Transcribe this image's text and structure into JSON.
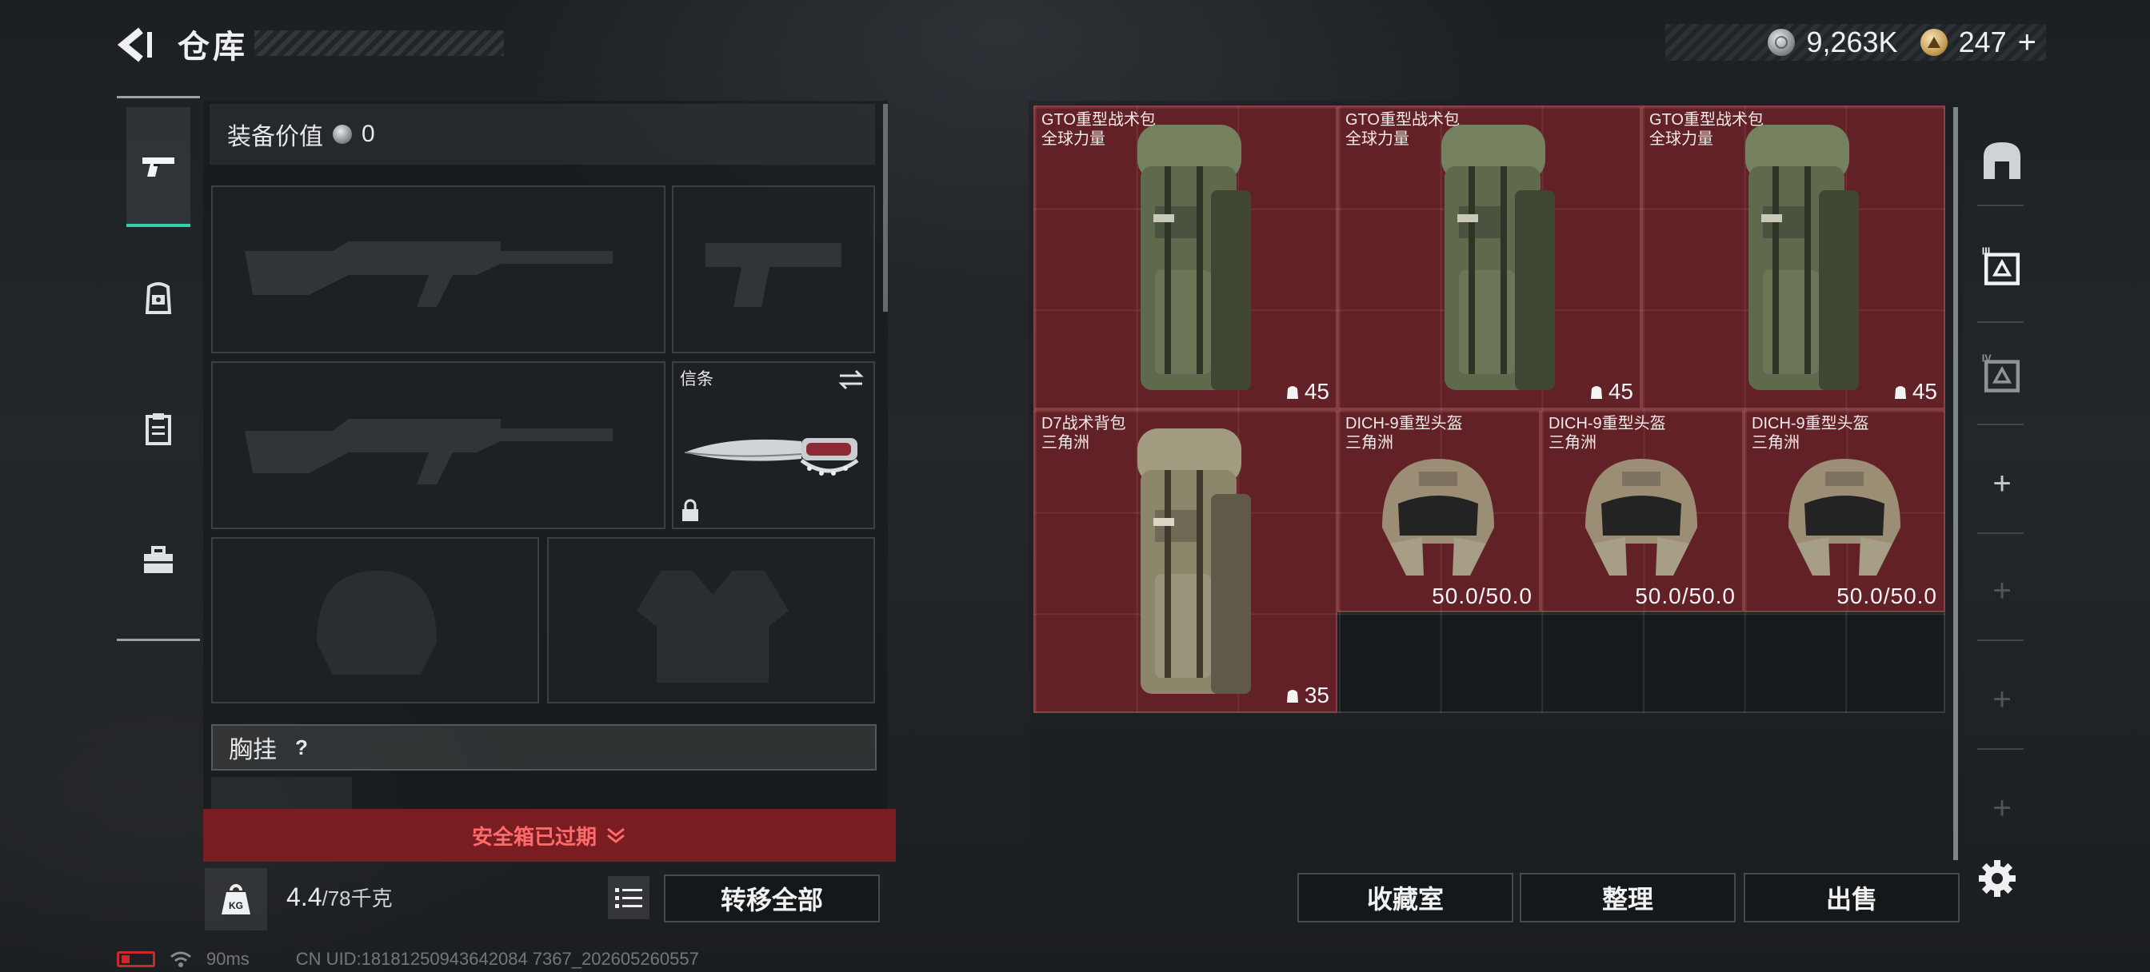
{
  "header": {
    "title": "仓库",
    "back_icon": "back-arrow-icon"
  },
  "currency": {
    "silver_amount": "9,263K",
    "gold_amount": "247",
    "gold_add": "+",
    "silver_icon": "silver-coin-icon",
    "gold_icon": "gold-coin-icon"
  },
  "left_tabs": [
    {
      "icon": "pistol-icon",
      "active": true
    },
    {
      "icon": "backpack-icon",
      "active": false
    },
    {
      "icon": "clipboard-icon",
      "active": false
    },
    {
      "icon": "toolbox-icon",
      "active": false
    }
  ],
  "loadout": {
    "value_label": "装备价值",
    "value_amount": "0",
    "melee_slot_label": "信条",
    "chest_rig_label": "胸挂",
    "chest_rig_help": "?"
  },
  "safebox": {
    "banner_text": "安全箱已过期"
  },
  "weight": {
    "current": "4.4",
    "max": "/78千克",
    "icon_text": "KG"
  },
  "buttons": {
    "transfer_all": "转移全部",
    "collection_room": "收藏室",
    "organize": "整理",
    "sell": "出售"
  },
  "stash_items": [
    {
      "name": "GTO重型战术包",
      "sub": "全球力量",
      "count": "45",
      "kind": "backpack-green"
    },
    {
      "name": "GTO重型战术包",
      "sub": "全球力量",
      "count": "45",
      "kind": "backpack-green"
    },
    {
      "name": "GTO重型战术包",
      "sub": "全球力量",
      "count": "45",
      "kind": "backpack-green"
    },
    {
      "name": "D7战术背包",
      "sub": "三角洲",
      "count": "35",
      "kind": "backpack-tan"
    },
    {
      "name": "DICH-9重型头盔",
      "sub": "三角洲",
      "durability": "50.0/50.0",
      "kind": "helmet"
    },
    {
      "name": "DICH-9重型头盔",
      "sub": "三角洲",
      "durability": "50.0/50.0",
      "kind": "helmet"
    },
    {
      "name": "DICH-9重型头盔",
      "sub": "三角洲",
      "durability": "50.0/50.0",
      "kind": "helmet"
    }
  ],
  "right_rail": {
    "icons": [
      "vault-icon",
      "stash-page-3-icon",
      "stash-page-4-icon"
    ],
    "settings_icon": "gear-icon"
  },
  "status": {
    "ping": "90ms",
    "uid": "CN UID:18181250943642084 7367_202605260557"
  },
  "colors": {
    "accent_green": "#2fd1a5",
    "item_red": "#6e2228",
    "banner_red": "#7a1d22",
    "warning_text": "#ff6b6b"
  }
}
